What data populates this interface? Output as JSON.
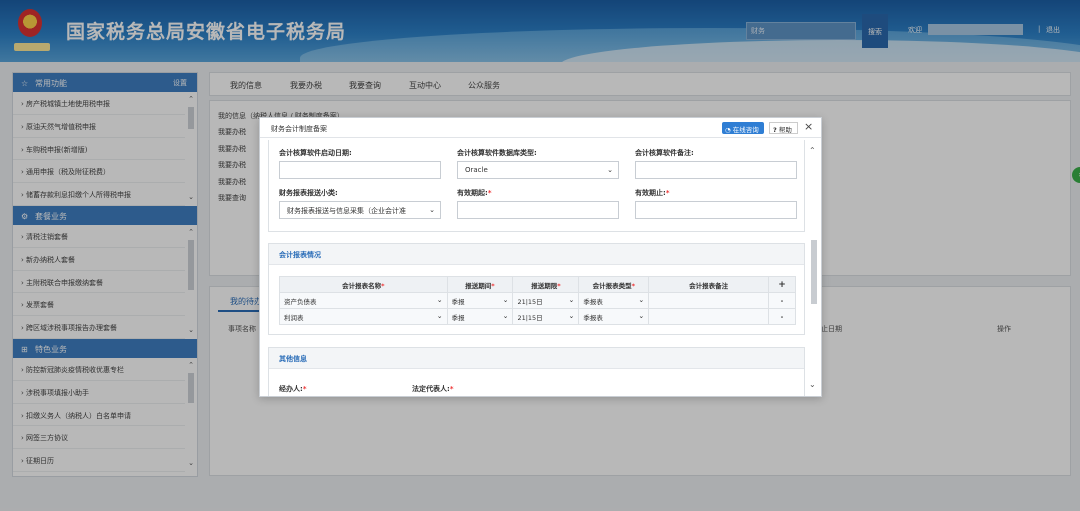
{
  "header": {
    "site_title": "国家税务总局安徽省电子税务局",
    "search_placeholder": "财务",
    "search_button": "搜索",
    "welcome": "欢迎",
    "separator": "|",
    "logout": "退出"
  },
  "sidebar": {
    "sections": [
      {
        "title": "常用功能",
        "icon": "star-icon",
        "action": "设置",
        "items": [
          "房产税城镇土地使用税申报",
          "原油天然气增值税申报",
          "车购税申报(新增版)",
          "通用申报（税及附征税费）",
          "储蓄存款利息扣缴个人所得税申报"
        ]
      },
      {
        "title": "套餐业务",
        "icon": "gear-icon",
        "items": [
          "清税注销套餐",
          "新办纳税人套餐",
          "主附税联合申报缴纳套餐",
          "发票套餐",
          "跨区域涉税事项报告办理套餐"
        ]
      },
      {
        "title": "特色业务",
        "icon": "grid-icon",
        "items": [
          "防控新冠肺炎疫情税收优惠专栏",
          "涉税事项填报小助手",
          "扣缴义务人（纳税人）白名单申请",
          "网签三方协议",
          "征期日历"
        ]
      }
    ]
  },
  "main": {
    "tabs": [
      "我的信息",
      "我要办税",
      "我要查询",
      "互动中心",
      "公众服务"
    ],
    "panel_lines": [
      "我的信息（纳税人信息 / 财务制度备案）",
      "我要办税",
      "我要办税",
      "我要办税",
      "我要办税",
      "我要查询"
    ],
    "todo_tab": "我的待办",
    "todo_cols": [
      "事项名称",
      "止日期",
      "操作"
    ]
  },
  "modal": {
    "title": "财务会计制度备案",
    "online_help": "在线咨询",
    "help": "帮助",
    "close": "×",
    "fields": {
      "start_date_label": "会计核算软件启动日期:",
      "db_type_label": "会计核算软件数据库类型:",
      "db_type_value": "Oracle",
      "remark_label": "会计核算软件备注:",
      "report_subclass_label": "财务报表报送小类:",
      "report_subclass_value": "财务报表报送与信息采集（企业会计准",
      "valid_from_label": "有效期起:",
      "valid_to_label": "有效期止:"
    },
    "report_section": {
      "title": "会计报表情况",
      "columns": [
        "会计报表名称",
        "报送期间",
        "报送期限",
        "会计报表类型",
        "会计报表备注",
        "+"
      ],
      "rows": [
        {
          "name": "资产负债表",
          "period": "季报",
          "deadline": "21|15日",
          "type": "季报表",
          "remark": "",
          "action": "-"
        },
        {
          "name": "利润表",
          "period": "季报",
          "deadline": "21|15日",
          "type": "季报表",
          "remark": "",
          "action": "-"
        }
      ]
    },
    "other_section": {
      "title": "其他信息",
      "handler_label": "经办人:",
      "legal_rep_label": "法定代表人:"
    }
  },
  "colors": {
    "accent": "#2a6db8",
    "section_head": "#3f7ec2",
    "required": "#e33333"
  }
}
